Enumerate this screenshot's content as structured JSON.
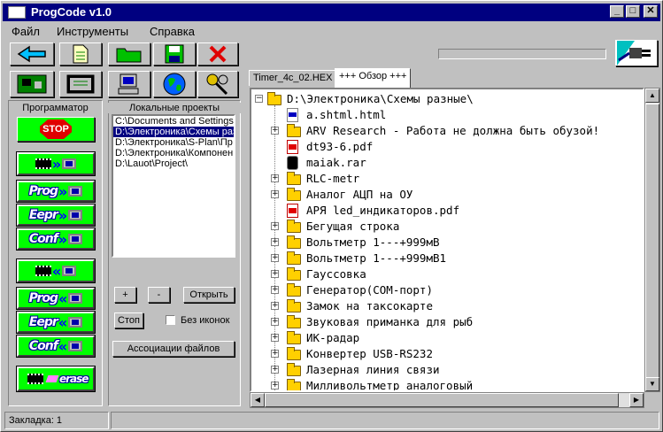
{
  "window": {
    "title": "ProgCode v1.0",
    "minimize": "_",
    "maximize": "□",
    "close": "✕"
  },
  "menu": [
    "Файл",
    "Инструменты",
    "Справка"
  ],
  "toolbar": {
    "icons": [
      "back-arrow-icon",
      "new-file-icon",
      "open-folder-icon",
      "save-floppy-icon",
      "delete-x-icon",
      "plug-icon"
    ]
  },
  "left": {
    "programmer_label": "Программатор",
    "stop_label": "STOP",
    "buttons": [
      {
        "label": "",
        "dir": "»"
      },
      {
        "label": "Prog",
        "dir": "»"
      },
      {
        "label": "Eepr",
        "dir": "»"
      },
      {
        "label": "Conf",
        "dir": "»"
      },
      {
        "label": "",
        "dir": "«"
      },
      {
        "label": "Prog",
        "dir": "«"
      },
      {
        "label": "Eepr",
        "dir": "«"
      },
      {
        "label": "Conf",
        "dir": "«"
      }
    ],
    "erase_label": "erase"
  },
  "projects": {
    "items": [
      "C:\\Documents and Settings\\",
      "D:\\Электроника\\Схемы разные",
      "D:\\Электроника\\S-Plan\\Пр",
      "D:\\Электроника\\Компонен",
      "D:\\Lauot\\Project\\"
    ],
    "selected": 1,
    "title": "Локальные проекты",
    "add": "+",
    "remove": "-",
    "open": "Открыть",
    "stop": "Стоп",
    "no_icons": "Без иконок",
    "assoc": "Ассоциации файлов"
  },
  "tabs": [
    "Timer_4c_02.HEX",
    "+++ Обзор +++"
  ],
  "tree": {
    "root": "D:\\Электроника\\Схемы разные\\",
    "items": [
      {
        "name": "a.shtml.html",
        "kind": "html",
        "expand": false
      },
      {
        "name": "ARV Research - Работа не должна быть обузой!",
        "kind": "folder",
        "expand": true
      },
      {
        "name": "dt93-6.pdf",
        "kind": "pdf",
        "expand": false
      },
      {
        "name": "maiak.rar",
        "kind": "rar",
        "expand": false
      },
      {
        "name": "RLC-metr",
        "kind": "folder",
        "expand": true
      },
      {
        "name": "Аналог АЦП на ОУ",
        "kind": "folder",
        "expand": true
      },
      {
        "name": "АРЯ led_индикаторов.pdf",
        "kind": "pdf",
        "expand": false
      },
      {
        "name": "Бегущая строка",
        "kind": "folder",
        "expand": true
      },
      {
        "name": "Вольтметр 1---+999мВ",
        "kind": "folder",
        "expand": true
      },
      {
        "name": "Вольтметр 1---+999мВ1",
        "kind": "folder",
        "expand": true
      },
      {
        "name": "Гауссовка",
        "kind": "folder",
        "expand": true
      },
      {
        "name": "Генератор(COM-порт)",
        "kind": "folder",
        "expand": true
      },
      {
        "name": "Замок на таксокарте",
        "kind": "folder",
        "expand": true
      },
      {
        "name": "Звуковая приманка для рыб",
        "kind": "folder",
        "expand": true
      },
      {
        "name": "ИК-радар",
        "kind": "folder",
        "expand": true
      },
      {
        "name": "Конвертер USB-RS232",
        "kind": "folder",
        "expand": true
      },
      {
        "name": "Лазерная линия связи",
        "kind": "folder",
        "expand": true
      },
      {
        "name": "Милливольтметр аналоговый",
        "kind": "folder",
        "expand": true
      }
    ]
  },
  "status": {
    "bookmark": "Закладка:  1"
  }
}
